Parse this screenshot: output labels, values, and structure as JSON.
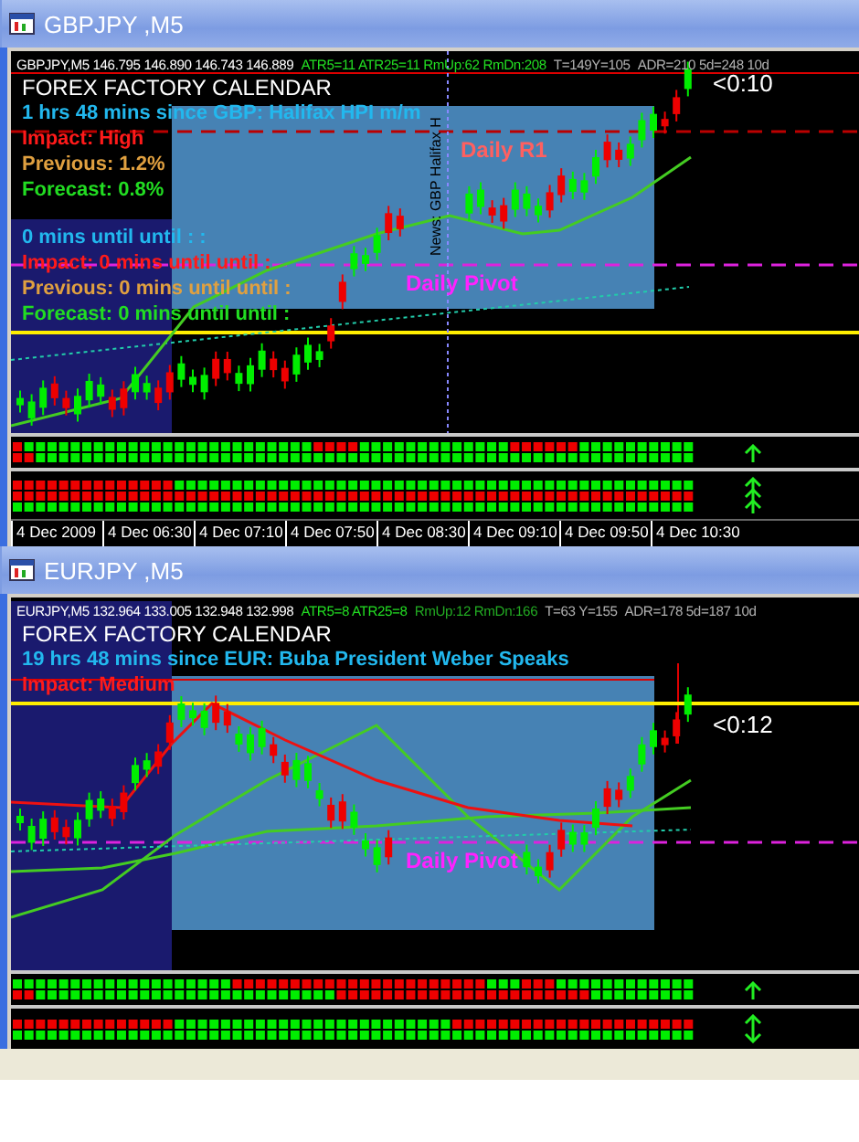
{
  "windows": [
    {
      "title": "GBPJPY ,M5",
      "header": [
        {
          "text": "GBPJPY,M5  146.795 146.890 146.743 146.889",
          "color": "#ffffff"
        },
        {
          "text": "ATR5=11  ATR25=11 RmUp:62 RmDn:208",
          "color": "#22dd22"
        },
        {
          "text": "T=149Y=105",
          "color": "#b0b0b0"
        },
        {
          "text": "ADR=210  5d=248  10d",
          "color": "#b0b0b0"
        }
      ],
      "calendar": [
        {
          "text": "FOREX FACTORY CALENDAR",
          "color": "#ffffff"
        },
        {
          "text": "1 hrs 48 mins since GBP: Halifax HPI m/m",
          "color": "#22b8ee"
        },
        {
          "text": "Impact: High",
          "color": "#ff1a1a"
        },
        {
          "text": "Previous: 1.2%",
          "color": "#e0a040"
        },
        {
          "text": "Forecast: 0.8%",
          "color": "#22dd22"
        },
        {
          "text": "0 mins until until : :",
          "color": "#22b8ee"
        },
        {
          "text": "Impact: 0 mins until until :",
          "color": "#ff1a1a"
        },
        {
          "text": "Previous: 0 mins until until :",
          "color": "#e0a040"
        },
        {
          "text": "Forecast: 0 mins until until :",
          "color": "#22dd22"
        }
      ],
      "levels": [
        {
          "label": "Daily R1",
          "color": "#ff6060"
        },
        {
          "label": "Daily Pivot",
          "color": "#ff22ff"
        }
      ],
      "news_marker": "News: GBP Halifax H",
      "timer": "<0:10",
      "indicator_panels": [
        {
          "rows": [
            [
              false,
              true,
              true,
              true,
              true,
              true,
              true,
              true,
              true,
              true,
              true,
              true,
              true,
              true,
              true,
              true,
              true,
              true,
              true,
              true,
              true,
              true,
              true,
              true,
              true,
              true,
              false,
              false,
              false,
              false,
              true,
              true,
              true,
              true,
              true,
              true,
              true,
              true,
              true,
              true,
              true,
              true,
              true,
              false,
              false,
              false,
              false,
              false,
              false,
              true,
              true,
              true,
              true,
              true,
              true,
              true,
              true,
              true,
              true
            ],
            [
              false,
              false,
              true,
              true,
              true,
              true,
              true,
              true,
              true,
              true,
              true,
              true,
              true,
              true,
              true,
              true,
              true,
              true,
              true,
              true,
              true,
              true,
              true,
              true,
              true,
              true,
              true,
              true,
              true,
              true,
              true,
              true,
              true,
              true,
              true,
              true,
              true,
              true,
              true,
              true,
              true,
              true,
              true,
              true,
              true,
              true,
              true,
              true,
              true,
              true,
              true,
              true,
              true,
              true,
              true,
              true,
              true,
              true,
              true
            ]
          ],
          "arrow": {
            "kind": "up"
          }
        },
        {
          "rows": [
            [
              false,
              false,
              false,
              false,
              false,
              false,
              false,
              false,
              false,
              false,
              false,
              false,
              false,
              false,
              true,
              true,
              true,
              true,
              true,
              true,
              true,
              true,
              true,
              true,
              true,
              true,
              true,
              true,
              true,
              true,
              true,
              true,
              true,
              true,
              true,
              true,
              true,
              true,
              true,
              true,
              true,
              true,
              true,
              true,
              true,
              true,
              true,
              true,
              true,
              true,
              true,
              true,
              true,
              true,
              true,
              true,
              true,
              true,
              true
            ],
            [
              false,
              false,
              false,
              false,
              false,
              false,
              false,
              false,
              false,
              false,
              false,
              false,
              false,
              false,
              false,
              false,
              false,
              false,
              false,
              false,
              false,
              false,
              false,
              false,
              false,
              false,
              false,
              false,
              false,
              false,
              false,
              false,
              false,
              false,
              false,
              false,
              false,
              false,
              false,
              false,
              false,
              false,
              false,
              false,
              false,
              false,
              false,
              false,
              false,
              false,
              false,
              false,
              false,
              false,
              false,
              false,
              false,
              false,
              false
            ],
            [
              true,
              true,
              true,
              true,
              true,
              true,
              true,
              true,
              true,
              true,
              true,
              true,
              true,
              true,
              true,
              true,
              true,
              true,
              true,
              true,
              true,
              true,
              true,
              true,
              true,
              true,
              true,
              true,
              true,
              true,
              true,
              true,
              true,
              true,
              true,
              true,
              true,
              true,
              true,
              true,
              true,
              true,
              true,
              true,
              true,
              true,
              true,
              true,
              true,
              true,
              true,
              true,
              true,
              true,
              true,
              true,
              true,
              true,
              true
            ]
          ],
          "arrow": {
            "kind": "triple-up"
          }
        }
      ],
      "time_axis": [
        "4 Dec 2009",
        "4 Dec 06:30",
        "4 Dec 07:10",
        "4 Dec 07:50",
        "4 Dec 08:30",
        "4 Dec 09:10",
        "4 Dec 09:50",
        "4 Dec 10:30"
      ]
    },
    {
      "title": "EURJPY ,M5",
      "header": [
        {
          "text": "EURJPY,M5  132.964 133.005 132.948 132.998",
          "color": "#ffffff"
        },
        {
          "text": "ATR5=8  ATR25=8",
          "color": "#22dd22"
        },
        {
          "text": "RmUp:12 RmDn:166",
          "color": "#22aa22"
        },
        {
          "text": "T=63  Y=155",
          "color": "#b0b0b0"
        },
        {
          "text": "ADR=178  5d=187  10d",
          "color": "#b0b0b0"
        }
      ],
      "calendar": [
        {
          "text": "FOREX FACTORY CALENDAR",
          "color": "#ffffff"
        },
        {
          "text": "19 hrs 48 mins since EUR: Buba President Weber Speaks",
          "color": "#22b8ee"
        },
        {
          "text": "Impact: Medium",
          "color": "#ff1a1a"
        }
      ],
      "levels": [
        {
          "label": "Daily Pivot",
          "color": "#ff22ff"
        }
      ],
      "timer": "<0:12",
      "indicator_panels": [
        {
          "rows": [
            [
              true,
              true,
              true,
              true,
              true,
              true,
              true,
              true,
              true,
              true,
              true,
              true,
              true,
              true,
              true,
              true,
              true,
              true,
              true,
              false,
              false,
              false,
              false,
              false,
              false,
              false,
              false,
              false,
              false,
              false,
              false,
              false,
              false,
              false,
              false,
              false,
              false,
              false,
              false,
              false,
              false,
              true,
              true,
              true,
              false,
              false,
              false,
              true,
              true,
              true,
              true,
              true,
              true,
              true,
              true,
              true,
              true,
              true,
              true
            ],
            [
              false,
              false,
              true,
              true,
              true,
              true,
              true,
              true,
              true,
              true,
              true,
              true,
              true,
              true,
              true,
              true,
              true,
              true,
              true,
              true,
              true,
              true,
              true,
              true,
              true,
              true,
              true,
              true,
              false,
              false,
              false,
              false,
              false,
              false,
              false,
              false,
              false,
              false,
              false,
              false,
              false,
              false,
              false,
              false,
              false,
              false,
              false,
              false,
              false,
              false,
              true,
              true,
              true,
              true,
              true,
              true,
              true,
              true,
              true
            ]
          ],
          "arrow": {
            "kind": "up"
          }
        },
        {
          "rows": [
            [
              false,
              false,
              false,
              false,
              false,
              false,
              false,
              false,
              false,
              false,
              false,
              false,
              false,
              false,
              true,
              true,
              true,
              true,
              true,
              true,
              true,
              true,
              true,
              true,
              true,
              true,
              true,
              true,
              true,
              true,
              true,
              true,
              true,
              true,
              true,
              true,
              true,
              true,
              false,
              false,
              false,
              false,
              false,
              false,
              false,
              false,
              false,
              false,
              false,
              false,
              false,
              false,
              false,
              false,
              false,
              false,
              false,
              false,
              false
            ],
            [
              true,
              true,
              true,
              true,
              true,
              true,
              true,
              true,
              true,
              true,
              true,
              true,
              true,
              true,
              true,
              true,
              true,
              true,
              true,
              true,
              true,
              true,
              true,
              true,
              true,
              true,
              true,
              true,
              true,
              true,
              true,
              true,
              true,
              true,
              true,
              true,
              true,
              true,
              true,
              true,
              true,
              true,
              true,
              true,
              true,
              true,
              true,
              true,
              true,
              true,
              true,
              true,
              true,
              true,
              true,
              true,
              true,
              true,
              true
            ]
          ],
          "arrow": {
            "kind": "up-down"
          }
        }
      ]
    }
  ]
}
